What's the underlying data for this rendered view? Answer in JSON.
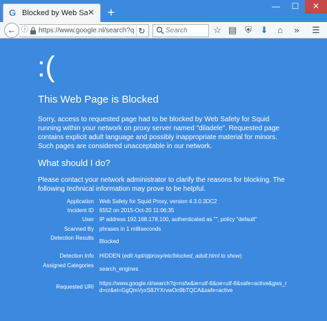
{
  "browser": {
    "tab": {
      "favicon": "G",
      "title": "Blocked by Web Safety fo...",
      "close": "✕"
    },
    "new_tab": "+",
    "window_controls": {
      "minimize": "—",
      "maximize": "☐",
      "close": "✕"
    },
    "url": "https://www.google.nl/search?q=nsfw&",
    "search_placeholder": "Search",
    "toolbar_icons": [
      "star-icon",
      "clipboard-icon",
      "shield-icon",
      "download-icon",
      "home-icon",
      "overflow-icon",
      "menu-icon"
    ],
    "colors": {
      "page_bg": "#3c8ae0",
      "chrome_bg": "#f5f6f7",
      "close_red": "#c74848"
    }
  },
  "page": {
    "emoticon": ":(",
    "title": "This Web Page is Blocked",
    "intro": "Sorry, access to requested page had to be blocked by Web Safety for Squid running within your network on proxy server named \"diladele\". Requested page contains explicit adult language and possibly inappropriate material for minors. Such pages are considered unacceptable in our network.",
    "what_heading": "What should I do?",
    "what_text": "Please contact your network administrator to clarify the reasons for blocking. The following technical information may prove to be helpful.",
    "details": [
      {
        "key": "Application",
        "value": "Web Safety for Squid Proxy, version 4.3.0.3DC2"
      },
      {
        "key": "Incident ID",
        "value": "6552 on 2015-Oct-20 11:06:35"
      },
      {
        "key": "User",
        "value": "IP address 192.168.178.100, authenticated as \"\", policy \"default\""
      },
      {
        "key": "Scanned By",
        "value": "phrases in 1 milliseconds"
      },
      {
        "key": "Detection Results",
        "value": "Blocked"
      },
      {
        "key": "Detection Info",
        "value_prefix": "HIDDEN (",
        "value_italic": "edit /opt/qlproxy/etc/blocked_adult.html to show",
        "value_suffix": ")"
      },
      {
        "key": "Assigned Categories",
        "value": "search_engines"
      },
      {
        "key": "Requested URI",
        "value": "https://www.google.nl/search?q=nsfw&ie=utf-8&oe=utf-8&safe=active&gws_rd=cr&ei=GgQmVyxS8JYXrvwOn9bTQCA&safe=active"
      }
    ]
  }
}
